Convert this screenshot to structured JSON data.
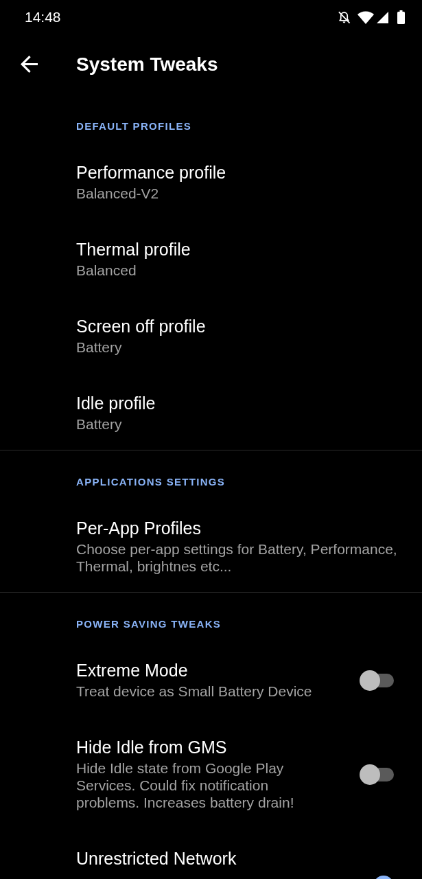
{
  "status_bar": {
    "time": "14:48"
  },
  "toolbar": {
    "title": "System Tweaks"
  },
  "sections": [
    {
      "header": "DEFAULT PROFILES",
      "items": [
        {
          "kind": "choice",
          "title": "Performance profile",
          "summary": "Balanced-V2"
        },
        {
          "kind": "choice",
          "title": "Thermal profile",
          "summary": "Balanced"
        },
        {
          "kind": "choice",
          "title": "Screen off profile",
          "summary": "Battery"
        },
        {
          "kind": "choice",
          "title": "Idle profile",
          "summary": "Battery"
        }
      ]
    },
    {
      "header": "APPLICATIONS SETTINGS",
      "items": [
        {
          "kind": "choice",
          "title": "Per-App Profiles",
          "summary": "Choose per-app settings for Battery, Performance, Thermal, brightnes etc..."
        }
      ]
    },
    {
      "header": "POWER SAVING TWEAKS",
      "items": [
        {
          "kind": "switch",
          "title": "Extreme Mode",
          "summary": "Treat device as Small Battery Device",
          "checked": false
        },
        {
          "kind": "switch",
          "title": "Hide Idle from GMS",
          "summary": "Hide Idle state from Google Play Services. Could fix notification problems. Increases battery drain!",
          "checked": false
        },
        {
          "kind": "switch",
          "title": "Unrestricted Network",
          "checked": true
        }
      ]
    }
  ]
}
